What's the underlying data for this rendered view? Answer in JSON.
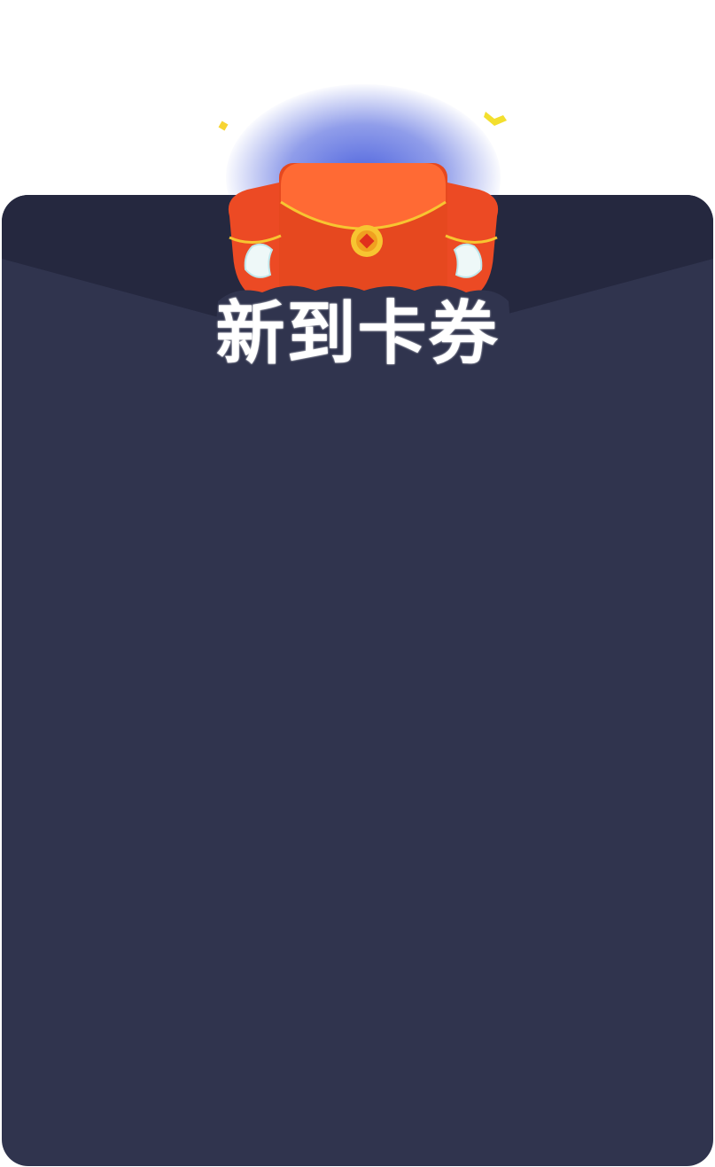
{
  "dialog": {
    "title": "新到卡券"
  },
  "colors": {
    "card_background": "#30344e",
    "card_flap": "#25283f",
    "envelope_red": "#f0542c",
    "envelope_gold": "#f7c531",
    "glow_blue": "#465cdc",
    "title_text": "#ffffff"
  },
  "icons": {
    "envelope": "red-envelope-icon",
    "confetti": "confetti-icon"
  }
}
